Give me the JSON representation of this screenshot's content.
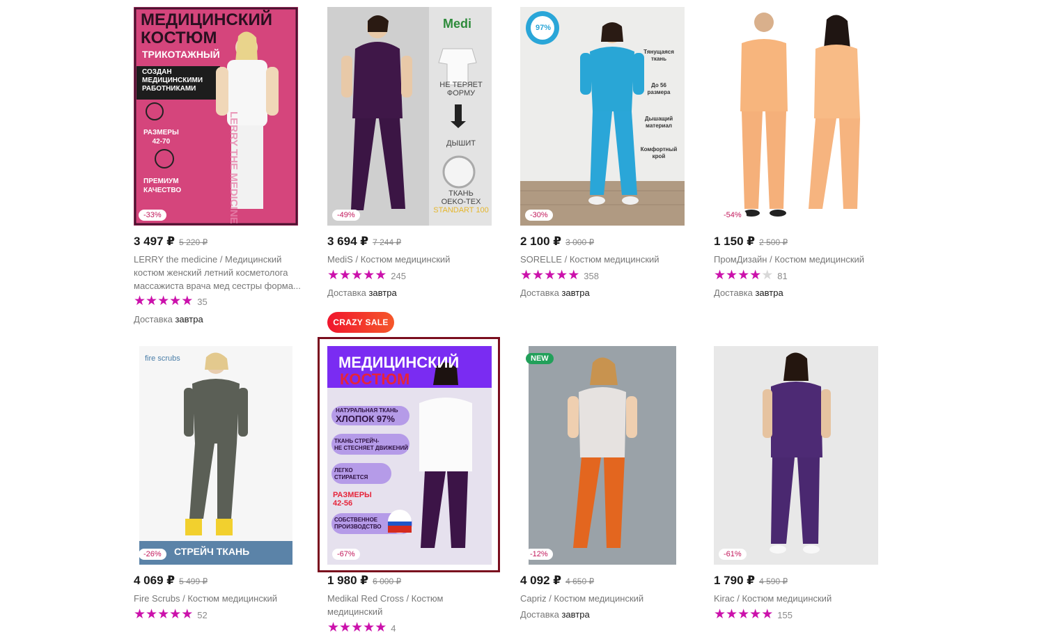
{
  "products": [
    {
      "price": "3 497 ₽",
      "old_price": "5 220 ₽",
      "discount": "-33%",
      "brand": "LERRY the medicine",
      "name": "Медицинский костюм женский летний косметолога массажиста врача мед сестры форма...",
      "rating": 5,
      "reviews": "35",
      "delivery_label": "Доставка",
      "delivery_day": "завтра",
      "image_text": {
        "title_1": "МЕДИЦИНСКИЙ",
        "title_2": "КОСТЮМ",
        "subtitle": "ТРИКОТАЖНЫЙ",
        "banner_1": "СОЗДАН",
        "banner_2": "МЕДИЦИНСКИМИ",
        "banner_3": "РАБОТНИКАМИ",
        "sizes_1": "РАЗМЕРЫ",
        "sizes_2": "42-70",
        "premium_1": "ПРЕМИУМ",
        "premium_2": "КАЧЕСТВО",
        "side": "LERRY THE MEDICINE"
      }
    },
    {
      "price": "3 694 ₽",
      "old_price": "7 244 ₽",
      "discount": "-49%",
      "brand": "MediS",
      "name": "Костюм медицинский",
      "rating": 5,
      "reviews": "245",
      "delivery_label": "Доставка",
      "delivery_day": "завтра",
      "badge": "CRAZY SALE",
      "image_text": {
        "logo": "Medi",
        "feat_1a": "НЕ ТЕРЯЕТ",
        "feat_1b": "ФОРМУ",
        "feat_2": "ДЫШИТ",
        "feat_3a": "ТКАНЬ",
        "feat_3b": "OEKO-TEX",
        "feat_3c": "STANDART 100"
      }
    },
    {
      "price": "2 100 ₽",
      "old_price": "3 000 ₽",
      "discount": "-30%",
      "brand": "SORELLE",
      "name": "Костюм медицинский",
      "rating": 5,
      "reviews": "358",
      "delivery_label": "Доставка",
      "delivery_day": "завтра",
      "image_text": {
        "badge": "97%",
        "f1a": "Тянущаяся",
        "f1b": "ткань",
        "f2a": "До 56",
        "f2b": "размера",
        "f3a": "Дышащий",
        "f3b": "материал",
        "f4a": "Комфортный",
        "f4b": "крой"
      }
    },
    {
      "price": "1 150 ₽",
      "old_price": "2 500 ₽",
      "discount": "-54%",
      "brand": "ПромДизайн",
      "name": "Костюм медицинский",
      "rating": 4,
      "reviews": "81",
      "delivery_label": "Доставка",
      "delivery_day": "завтра"
    },
    {
      "price": "4 069 ₽",
      "old_price": "5 499 ₽",
      "discount": "-26%",
      "brand": "Fire Scrubs",
      "name": "Костюм медицинский",
      "rating": 5,
      "reviews": "52",
      "image_text": {
        "logo": "fire scrubs",
        "banner": "СТРЕЙЧ ТКАНЬ"
      }
    },
    {
      "price": "1 980 ₽",
      "old_price": "6 000 ₽",
      "discount": "-67%",
      "brand": "Medikal Red Cross",
      "name": "Костюм медицинский",
      "rating": 5,
      "reviews": "4",
      "image_text": {
        "title_1": "МЕДИЦИНСКИЙ",
        "title_2": "КОСТЮМ",
        "p1a": "НАТУРАЛЬНАЯ ТКАНЬ",
        "p1b": "ХЛОПОК 97%",
        "p2a": "ТКАНЬ СТРЕЙЧ-",
        "p2b": "НЕ СТЕСНЯЕТ ДВИЖЕНИЙ",
        "p3a": "ЛЕГКО",
        "p3b": "СТИРАЕТСЯ",
        "sizes_1": "РАЗМЕРЫ",
        "sizes_2": "42-56",
        "p4a": "СОБСТВЕННОЕ",
        "p4b": "ПРОИЗВОДСТВО"
      }
    },
    {
      "price": "4 092 ₽",
      "old_price": "4 650 ₽",
      "discount": "-12%",
      "brand": "Capriz",
      "name": "Костюм медицинский",
      "new_badge": "NEW",
      "delivery_label": "Доставка",
      "delivery_day": "завтра"
    },
    {
      "price": "1 790 ₽",
      "old_price": "4 590 ₽",
      "discount": "-61%",
      "brand": "Kirac",
      "name": "Костюм медицинский",
      "rating": 5,
      "reviews": "155"
    }
  ],
  "colors": {
    "star": "#cb11ab",
    "discount_text": "#c2185b",
    "crazy_sale": "#f0162d",
    "new_badge": "#22a05a",
    "selected_border": "#7a0e1e"
  },
  "icons": [
    "star-icon",
    "ruble-sign"
  ]
}
